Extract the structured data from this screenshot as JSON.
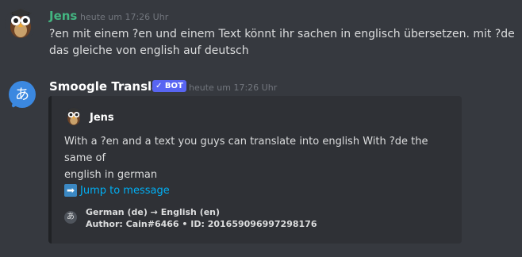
{
  "messages": [
    {
      "author": "Jens",
      "author_color": "#43b581",
      "timestamp": "heute um 17:26 Uhr",
      "content_line1": "?en mit einem ?en und einem Text könnt ihr sachen in englisch übersetzen. mit ?de",
      "content_line2": "das gleiche von english auf deutsch"
    },
    {
      "author": "Smoogle Translate",
      "bot_badge": "✓ BOT",
      "timestamp": "heute um 17:26 Uhr"
    }
  ],
  "embed": {
    "author": "Jens",
    "description_line1": "With a ?en and a text you guys can translate into english With ?de the same of",
    "description_line2": "english in german",
    "jump_label": "Jump to message",
    "footer_line1": "German (de) → English (en)",
    "footer_line2": "Author: Cain#6466 • ID: 201659096997298176"
  }
}
